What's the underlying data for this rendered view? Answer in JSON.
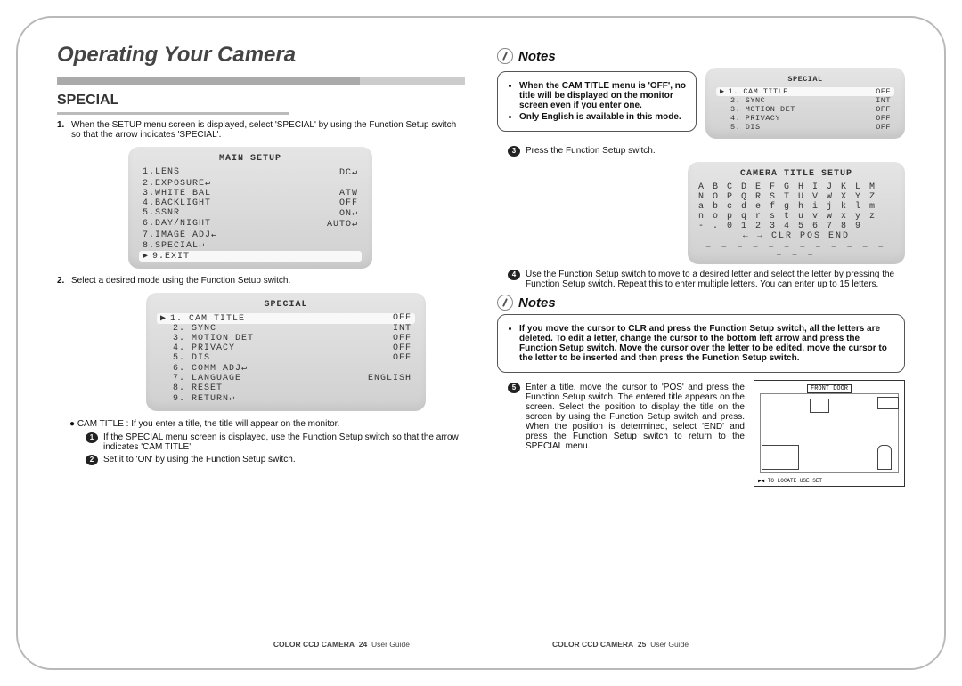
{
  "chapterTitle": "Operating Your Camera",
  "section": {
    "title": "SPECIAL",
    "step1": "When the SETUP menu screen is displayed, select 'SPECIAL' by using the Function Setup switch so that the arrow indicates 'SPECIAL'.",
    "step2": "Select a desired mode using the Function Setup switch.",
    "camTitleLead": "CAM TITLE : If you enter a title, the title will appear on the monitor.",
    "sub1": "If the SPECIAL menu screen is displayed, use the Function Setup switch so that the arrow indicates 'CAM TITLE'.",
    "sub2": "Set it to 'ON' by using the Function Setup switch."
  },
  "mainSetup": {
    "title": "MAIN SETUP",
    "rows": [
      {
        "l": "1.LENS",
        "r": "DC↵"
      },
      {
        "l": "2.EXPOSURE↵",
        "r": ""
      },
      {
        "l": "3.WHITE BAL",
        "r": "ATW"
      },
      {
        "l": "4.BACKLIGHT",
        "r": "OFF"
      },
      {
        "l": "5.SSNR",
        "r": "ON↵"
      },
      {
        "l": "6.DAY/NIGHT",
        "r": "AUTO↵"
      },
      {
        "l": "7.IMAGE ADJ↵",
        "r": ""
      },
      {
        "l": "8.SPECIAL↵",
        "r": ""
      }
    ],
    "exit": "9.EXIT"
  },
  "specialMenu": {
    "title": "SPECIAL",
    "rows": [
      {
        "l": "1. CAM TITLE",
        "r": "OFF",
        "hl": true
      },
      {
        "l": "2. SYNC",
        "r": "INT"
      },
      {
        "l": "3. MOTION DET",
        "r": "OFF"
      },
      {
        "l": "4. PRIVACY",
        "r": "OFF"
      },
      {
        "l": "5. DIS",
        "r": "OFF"
      },
      {
        "l": "6. COMM ADJ↵",
        "r": ""
      },
      {
        "l": "7. LANGUAGE",
        "r": "ENGLISH"
      },
      {
        "l": "8. RESET",
        "r": ""
      },
      {
        "l": "9. RETURN↵",
        "r": ""
      }
    ]
  },
  "notesTop": {
    "hdr": "Notes",
    "items": [
      "When the CAM TITLE menu is 'OFF', no title will be displayed on the monitor screen even if you enter one.",
      "Only English is available in this mode."
    ]
  },
  "specialMini": {
    "title": "SPECIAL",
    "rows": [
      {
        "l": "1. CAM TITLE",
        "r": "OFF",
        "hl": true
      },
      {
        "l": "2. SYNC",
        "r": "INT"
      },
      {
        "l": "3. MOTION DET",
        "r": "OFF"
      },
      {
        "l": "4. PRIVACY",
        "r": "OFF"
      },
      {
        "l": "5. DIS",
        "r": "OFF"
      }
    ]
  },
  "step3": "Press the Function Setup switch.",
  "titleSetup": {
    "title": "CAMERA TITLE SETUP",
    "l1": "A B C D E F G H I J K L M",
    "l2": "N O P Q R S T U V W X Y Z",
    "l3": "a b c d e f g h i j k l m",
    "l4": "n o p q r s t u v w x y z",
    "l5": "- . 0 1 2 3 4 5 6 7 8 9",
    "l6": "← → CLR POS END",
    "cursor": "_ _ _ _ _ _ _ _ _ _ _ _ _ _ _"
  },
  "step4": "Use the Function Setup switch to move to a desired letter and select the letter by pressing the Function Setup switch. Repeat this to enter multiple letters. You can enter up to 15 letters.",
  "notesMid": {
    "hdr": "Notes",
    "text": "If you move the cursor to CLR and press the Function Setup switch, all the letters are deleted. To edit a letter, change the cursor to the bottom left arrow and press the Function Setup switch. Move the cursor over the letter to be edited, move the cursor to the letter to be inserted and then press the Function Setup switch."
  },
  "step5": "Enter a title, move the cursor to 'POS' and press the Function Setup switch. The entered title appears on the screen. Select the position to display the title on the screen by using the Function Setup switch and press. When the position is determined, select 'END' and press the Function Setup switch to return to the SPECIAL menu.",
  "room": {
    "label": "FRONT DOOR",
    "bottom": "▶◀ TO LOCATE         USE SET"
  },
  "footer": {
    "leftBold": "COLOR CCD CAMERA",
    "leftPg": "24",
    "leftTxt": "User Guide",
    "rightBold": "COLOR CCD CAMERA",
    "rightPg": "25",
    "rightTxt": "User Guide"
  }
}
